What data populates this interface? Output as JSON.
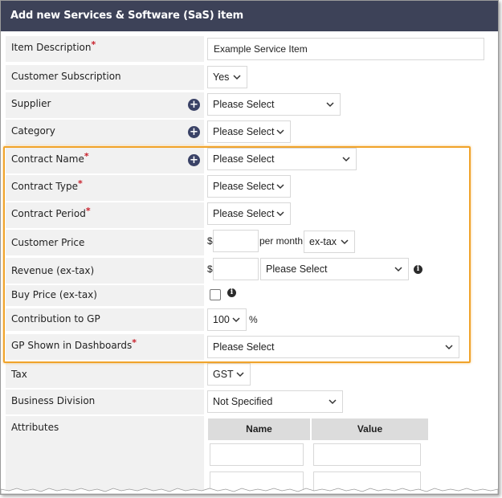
{
  "header": {
    "title": "Add new Services & Software (SaS) item"
  },
  "rows": {
    "item_description": {
      "label": "Item Description",
      "required": "*",
      "value": "Example Service Item"
    },
    "customer_subscription": {
      "label": "Customer Subscription",
      "value": "Yes"
    },
    "supplier": {
      "label": "Supplier",
      "value": "Please Select"
    },
    "category": {
      "label": "Category",
      "value": "Please Select"
    },
    "contract_name": {
      "label": "Contract Name",
      "required": "*",
      "value": "Please Select"
    },
    "contract_type": {
      "label": "Contract Type",
      "required": "*",
      "value": "Please Select"
    },
    "contract_period": {
      "label": "Contract Period",
      "required": "*",
      "value": "Please Select"
    },
    "customer_price": {
      "label": "Customer Price",
      "currency": "$",
      "value": "",
      "per_label": "per month",
      "tax_option": "ex-tax"
    },
    "revenue": {
      "label": "Revenue (ex-tax)",
      "currency": "$",
      "value": "",
      "select_value": "Please Select"
    },
    "buy_price": {
      "label": "Buy Price (ex-tax)"
    },
    "contribution": {
      "label": "Contribution to GP",
      "value": "100",
      "unit": "%"
    },
    "gp_dashboards": {
      "label": "GP Shown in Dashboards",
      "required": "*",
      "value": "Please Select"
    },
    "tax": {
      "label": "Tax",
      "value": "GST"
    },
    "business_division": {
      "label": "Business Division",
      "value": "Not Specified"
    },
    "attributes": {
      "label": "Attributes",
      "col_name": "Name",
      "col_value": "Value"
    }
  },
  "icons": {
    "add": "+",
    "info": "i"
  },
  "colors": {
    "header_bg": "#3d4258",
    "highlight": "#f0a32a",
    "required": "#c8202b",
    "plus_bg": "#3a4266"
  }
}
